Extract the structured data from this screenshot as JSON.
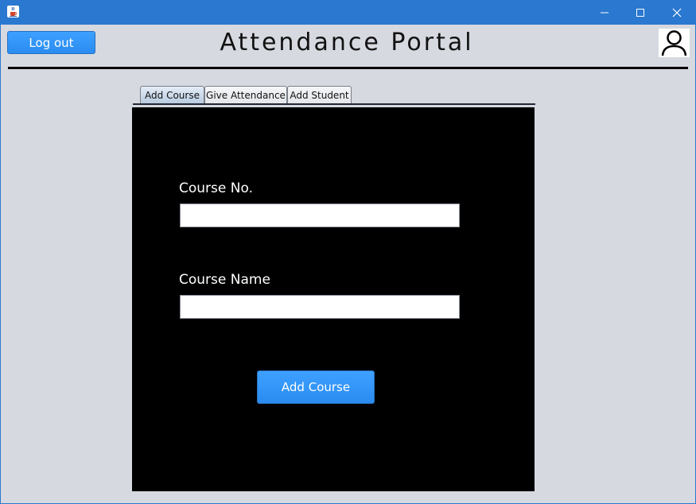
{
  "window": {
    "controls": [
      "minimize-icon",
      "maximize-icon",
      "close-icon"
    ],
    "app_icon": "java-cup-icon"
  },
  "header": {
    "logout_label": "Log out",
    "title": "Attendance  Portal",
    "avatar_icon": "user-icon"
  },
  "tabs": [
    {
      "label": "Add Course",
      "selected": true
    },
    {
      "label": "Give Attendance",
      "selected": false
    },
    {
      "label": "Add Student",
      "selected": false
    }
  ],
  "form": {
    "course_no_label": "Course No.",
    "course_no_value": "",
    "course_name_label": "Course Name",
    "course_name_value": "",
    "submit_label": "Add Course"
  },
  "colors": {
    "titlebar": "#2a78cf",
    "window_bg": "#d6d9e0",
    "panel_bg": "#000000",
    "button_accent": "#2f93f7"
  }
}
